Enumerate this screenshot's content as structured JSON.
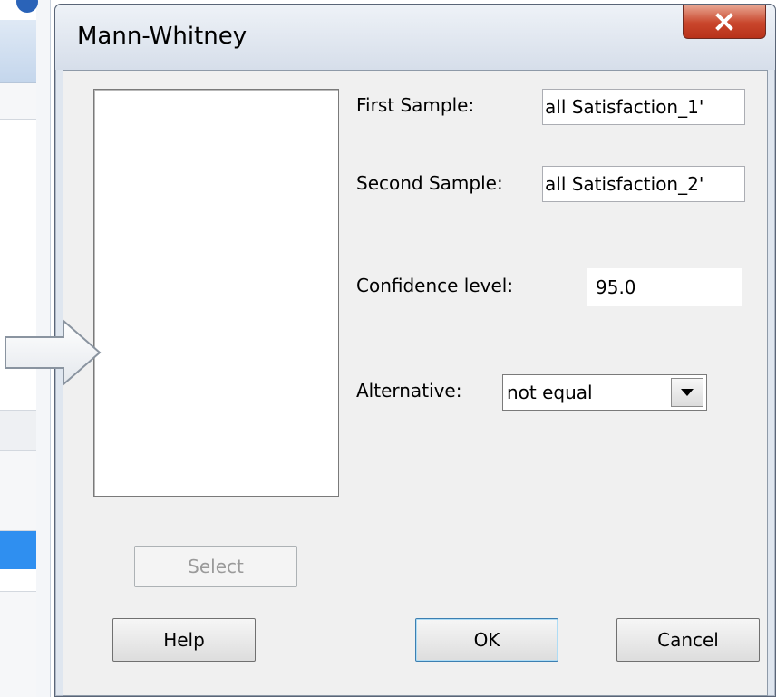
{
  "dialog": {
    "title": "Mann-Whitney",
    "close_icon": "close-icon"
  },
  "form": {
    "first_sample_label": "First Sample:",
    "first_sample_value": "all Satisfaction_1'",
    "second_sample_label": "Second Sample:",
    "second_sample_value": "all Satisfaction_2'",
    "confidence_label": "Confidence level:",
    "confidence_value": "95.0",
    "alternative_label": "Alternative:",
    "alternative_value": "not equal"
  },
  "buttons": {
    "select": "Select",
    "help": "Help",
    "ok": "OK",
    "cancel": "Cancel"
  },
  "colors": {
    "close_button": "#c9462c",
    "selection_blue": "#2f8ff0",
    "dialog_frame": "#dfe6ef"
  }
}
